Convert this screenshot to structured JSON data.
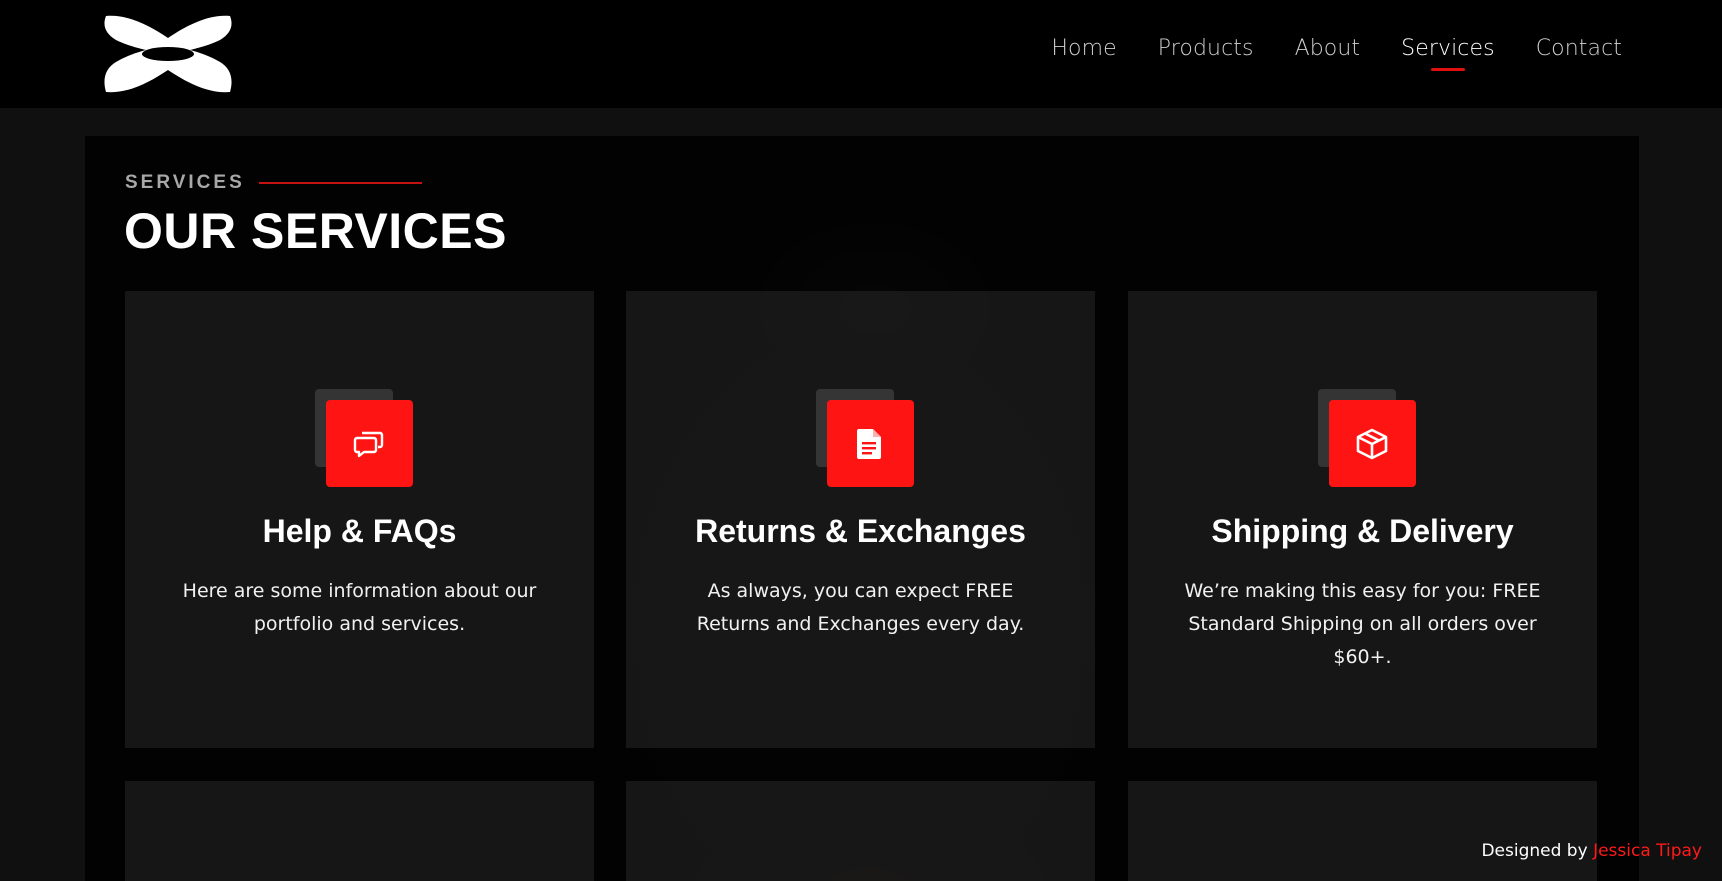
{
  "nav": {
    "items": [
      {
        "label": "Home",
        "active": false
      },
      {
        "label": "Products",
        "active": false
      },
      {
        "label": "About",
        "active": false
      },
      {
        "label": "Services",
        "active": true
      },
      {
        "label": "Contact",
        "active": false
      }
    ]
  },
  "section": {
    "eyebrow": "SERVICES",
    "title": "OUR SERVICES"
  },
  "services": [
    {
      "icon": "chat-bubbles-icon",
      "title": "Help & FAQs",
      "text": "Here are some information about our portfolio and services."
    },
    {
      "icon": "document-icon",
      "title": "Returns & Exchanges",
      "text": "As always, you can expect FREE Returns and Exchanges every day."
    },
    {
      "icon": "package-box-icon",
      "title": "Shipping & Delivery",
      "text": "We’re making this easy for you: FREE Standard Shipping on all orders over $60+."
    }
  ],
  "footer": {
    "prefix": "Designed by",
    "author": "Jessica Tipay"
  },
  "colors": {
    "accent": "#ff1414",
    "header_bg": "#000000",
    "card_bg": "#1c1c1c"
  }
}
